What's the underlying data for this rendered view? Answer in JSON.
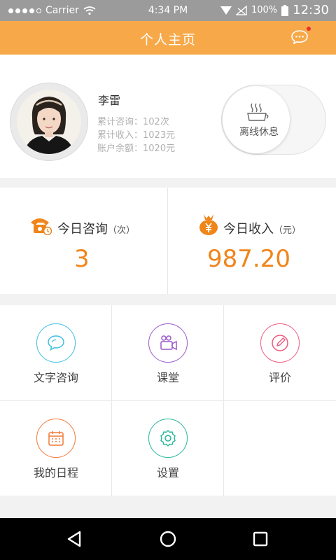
{
  "status_bar": {
    "carrier": "Carrier",
    "time_center": "4:34 PM",
    "battery_pct": "100%",
    "clock": "12:30"
  },
  "header": {
    "title": "个人主页"
  },
  "profile": {
    "name": "李雷",
    "stats": [
      "累计咨询：102次",
      "累计收入：1023元",
      "账户余额：1020元"
    ],
    "status_toggle_label": "离线休息"
  },
  "today": {
    "consult": {
      "label": "今日咨询",
      "unit": "（次）",
      "value": "3"
    },
    "income": {
      "label": "今日收入",
      "unit": "（元）",
      "value": "987.20"
    }
  },
  "menu": [
    {
      "label": "文字咨询",
      "icon": "chat-bubble-icon",
      "color": "#3fbfe0"
    },
    {
      "label": "课堂",
      "icon": "video-camera-icon",
      "color": "#9b59c9"
    },
    {
      "label": "评价",
      "icon": "pencil-icon",
      "color": "#ee5a7e"
    },
    {
      "label": "我的日程",
      "icon": "calendar-icon",
      "color": "#f07a3a"
    },
    {
      "label": "设置",
      "icon": "gear-icon",
      "color": "#27b69a"
    }
  ],
  "colors": {
    "accent": "#f7a94a",
    "value": "#f08519"
  }
}
